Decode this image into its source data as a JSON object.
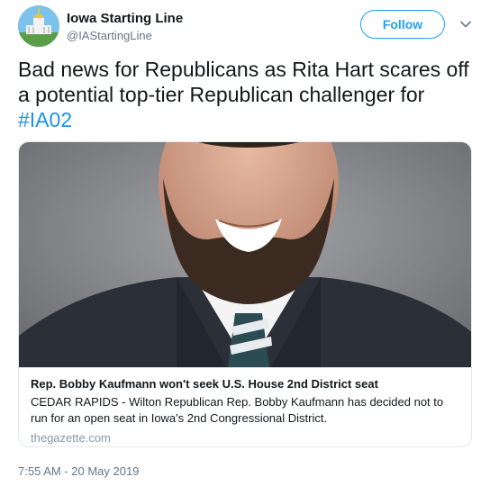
{
  "tweet": {
    "author_name": "Iowa Starting Line",
    "author_handle": "@IAStartingLine",
    "follow_label": "Follow",
    "text_main": "Bad news for Republicans as Rita Hart scares off a potential top-tier Republican challenger for ",
    "hashtag": "#IA02",
    "timestamp": "7:55 AM - 20 May 2019"
  },
  "card": {
    "title": "Rep. Bobby Kaufmann won't seek U.S. House 2nd District seat",
    "description": "CEDAR RAPIDS - Wilton Republican Rep. Bobby Kaufmann has decided not to run for an open seat in Iowa's 2nd Congressional District.",
    "domain": "thegazette.com"
  },
  "icons": {
    "avatar": "iowa-capitol-logo",
    "menu": "chevron-down-icon"
  },
  "colors": {
    "accent": "#1da1f2",
    "hashtag": "#1b95e0",
    "secondary_text": "#657786"
  }
}
